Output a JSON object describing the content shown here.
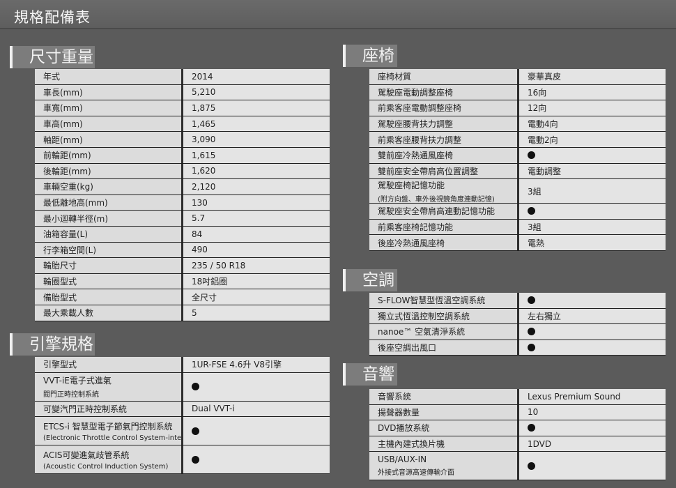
{
  "page": {
    "title": "規格配備表"
  },
  "sections": {
    "dimensions": {
      "title": "尺寸重量",
      "rows": [
        {
          "label": "年式",
          "value": "2014"
        },
        {
          "label": "車長(mm)",
          "value": "5,210"
        },
        {
          "label": "車寬(mm)",
          "value": "1,875"
        },
        {
          "label": "車高(mm)",
          "value": "1,465"
        },
        {
          "label": "軸距(mm)",
          "value": "3,090"
        },
        {
          "label": "前輪距(mm)",
          "value": "1,615"
        },
        {
          "label": "後輪距(mm)",
          "value": "1,620"
        },
        {
          "label": "車輛空重(kg)",
          "value": "2,120"
        },
        {
          "label": "最低離地高(mm)",
          "value": "130"
        },
        {
          "label": "最小迴轉半徑(m)",
          "value": "5.7"
        },
        {
          "label": "油箱容量(L)",
          "value": "84"
        },
        {
          "label": "行李箱空間(L)",
          "value": "490"
        },
        {
          "label": "輪胎尺寸",
          "value": "235 / 50 R18"
        },
        {
          "label": "輪圈型式",
          "value": "18吋鋁圈"
        },
        {
          "label": "備胎型式",
          "value": "全尺寸"
        },
        {
          "label": "最大乘載人數",
          "value": "5"
        }
      ]
    },
    "engine": {
      "title": "引擎規格",
      "rows": [
        {
          "label": "引擎型式",
          "value": "1UR-FSE 4.6升 V8引擎"
        },
        {
          "label": "VVT-iE電子式進氣",
          "sub": "閥門正時控制系統",
          "value": "●"
        },
        {
          "label": "可變汽門正時控制系統",
          "value": "Dual VVT-i"
        },
        {
          "label": "ETCS-i 智慧型電子節氣門控制系統",
          "sub": "(Electronic Throttle Control System-intelligent)",
          "value": "●"
        },
        {
          "label": "ACIS可變進氣歧管系統",
          "sub": "(Acoustic Control Induction System)",
          "value": "●"
        }
      ]
    },
    "seats": {
      "title": "座椅",
      "rows": [
        {
          "label": "座椅材質",
          "value": "豪華真皮"
        },
        {
          "label": "駕駛座電動調整座椅",
          "value": "16向"
        },
        {
          "label": "前乘客座電動調整座椅",
          "value": "12向"
        },
        {
          "label": "駕駛座腰背扶力調整",
          "value": "電動4向"
        },
        {
          "label": "前乘客座腰背扶力調整",
          "value": "電動2向"
        },
        {
          "label": "雙前座冷熱通風座椅",
          "value": "●"
        },
        {
          "label": "雙前座安全帶肩高位置調整",
          "value": "電動調整"
        },
        {
          "label": "駕駛座椅記憶功能",
          "sub": "(附方向盤、車外後視鏡角度連動記憶)",
          "value": "3組"
        },
        {
          "label": "駕駛座安全帶肩高連動記憶功能",
          "value": "●"
        },
        {
          "label": "前乘客座椅記憶功能",
          "value": "3組"
        },
        {
          "label": "後座冷熱通風座椅",
          "value": "電熱"
        }
      ]
    },
    "climate": {
      "title": "空調",
      "rows": [
        {
          "label": "S-FLOW智慧型恆溫空調系統",
          "value": "●"
        },
        {
          "label": "獨立式恆溫控制空調系統",
          "value": "左右獨立"
        },
        {
          "label": "nanoe™ 空氣清淨系統",
          "value": "●"
        },
        {
          "label": "後座空調出風口",
          "value": "●"
        }
      ]
    },
    "audio": {
      "title": "音響",
      "rows": [
        {
          "label": "音響系統",
          "value": "Lexus Premium Sound"
        },
        {
          "label": "揚聲器數量",
          "value": "10"
        },
        {
          "label": "DVD播放系統",
          "value": "●"
        },
        {
          "label": "主機內建式換片機",
          "value": "1DVD"
        },
        {
          "label": "USB/AUX-IN",
          "sub": "外接式音源高速傳輸介面",
          "value": "●"
        }
      ]
    }
  }
}
